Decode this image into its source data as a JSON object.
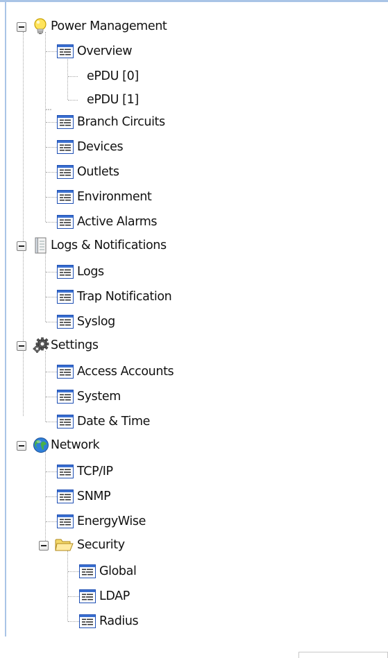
{
  "tree": {
    "power_management": {
      "label": "Power Management",
      "icon": "lightbulb-icon",
      "children": {
        "overview": {
          "label": "Overview",
          "children": [
            "ePDU [0]",
            "ePDU [1]"
          ]
        },
        "branch_circuits": "Branch Circuits",
        "devices": "Devices",
        "outlets": "Outlets",
        "environment": "Environment",
        "active_alarms": "Active Alarms"
      }
    },
    "logs_notifications": {
      "label": "Logs & Notifications",
      "icon": "notebook-icon",
      "children": {
        "logs": "Logs",
        "trap_notification": "Trap Notification",
        "syslog": "Syslog"
      }
    },
    "settings": {
      "label": "Settings",
      "icon": "gears-icon",
      "children": {
        "access_accounts": "Access Accounts",
        "system": "System",
        "date_time": "Date & Time"
      }
    },
    "network": {
      "label": "Network",
      "icon": "globe-icon",
      "children": {
        "tcp_ip": "TCP/IP",
        "snmp": "SNMP",
        "energywise": "EnergyWise",
        "security": {
          "label": "Security",
          "icon": "folder-open-icon",
          "children": {
            "global": "Global",
            "ldap": "LDAP",
            "radius": "Radius"
          }
        }
      }
    }
  },
  "colors": {
    "frame_border": "#a9c4e6",
    "tree_lines": "#a5a5a5",
    "page_icon_blue": "#1e4fb4",
    "text": "#111111"
  }
}
